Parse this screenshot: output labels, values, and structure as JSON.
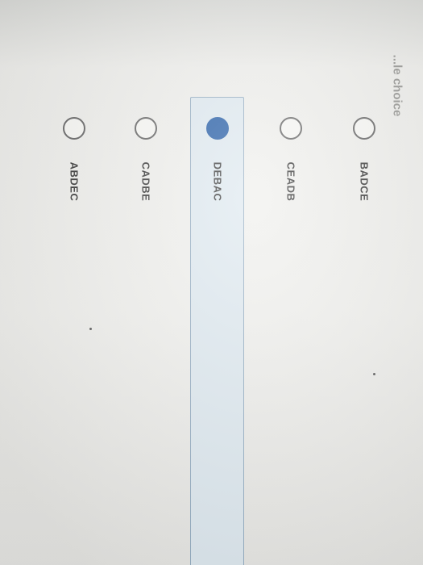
{
  "question": {
    "title_fragment": "...le choice",
    "options": [
      {
        "label": "BADCE",
        "selected": false
      },
      {
        "label": "CEADB",
        "selected": false
      },
      {
        "label": "DEBAC",
        "selected": true
      },
      {
        "label": "CADBE",
        "selected": false
      },
      {
        "label": "ABDEC",
        "selected": false
      }
    ],
    "colors": {
      "selected_fill": "#1d57a3",
      "selected_panel": "#dde8ef",
      "panel_border": "#8fa9bf"
    }
  }
}
